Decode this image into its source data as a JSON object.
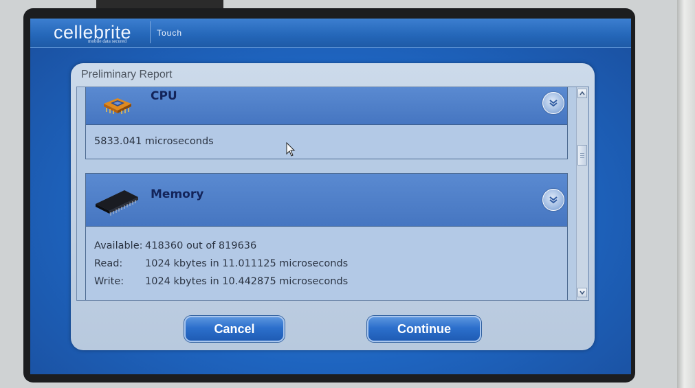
{
  "app": {
    "brand": "cellebrite",
    "tagline": "mobile data secured",
    "product": "Touch"
  },
  "dialog": {
    "title": "Preliminary Report",
    "sections": [
      {
        "title": "CPU",
        "icon": "cpu-chip-icon",
        "value": "5833.041 microseconds"
      },
      {
        "title": "Memory",
        "icon": "memory-module-icon",
        "rows": [
          {
            "label": "Available:",
            "value": "418360 out of 819636"
          },
          {
            "label": "Read:",
            "value": "1024 kbytes in 11.011125 microseconds"
          },
          {
            "label": "Write:",
            "value": "1024 kbytes in 10.442875 microseconds"
          }
        ]
      }
    ],
    "buttons": {
      "cancel": "Cancel",
      "continue": "Continue"
    }
  },
  "colors": {
    "screen_blue": "#1e64bf",
    "section_header": "#4676c1",
    "button_blue": "#2c6fcc"
  }
}
